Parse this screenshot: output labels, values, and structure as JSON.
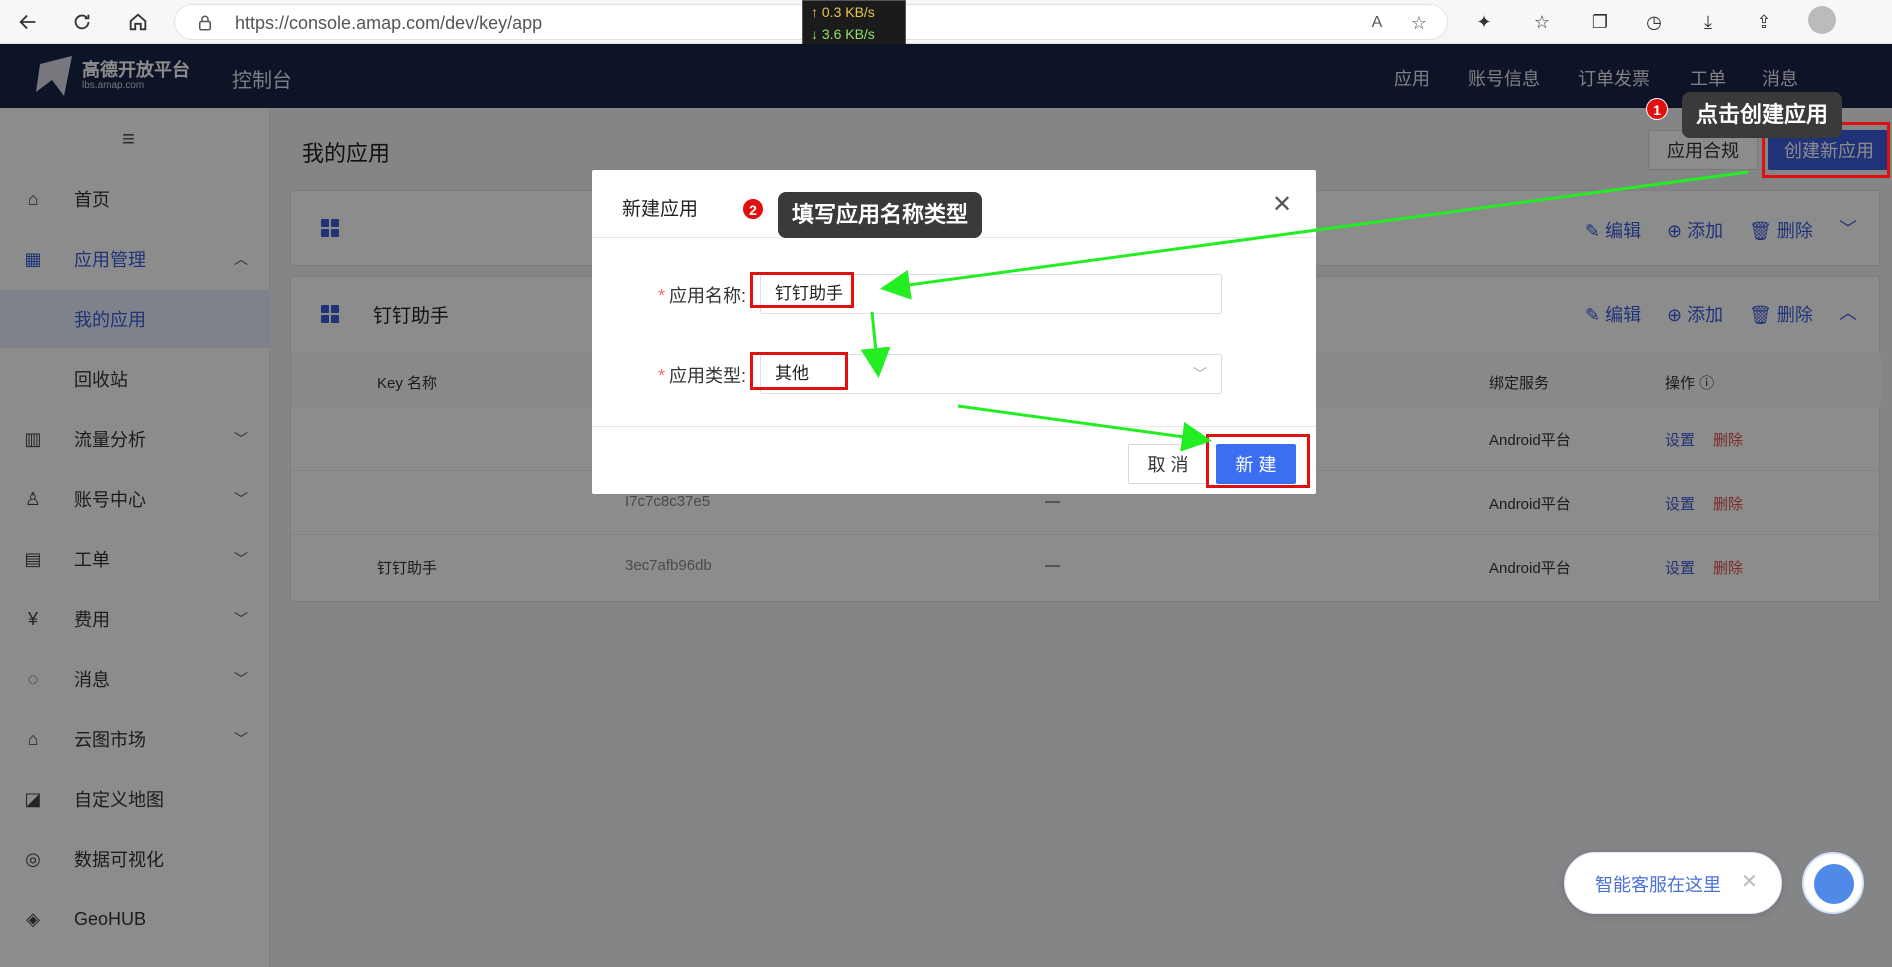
{
  "browser": {
    "url": "https://console.amap.com/dev/key/app",
    "net_up": "↑ 0.3 KB/s",
    "net_down": "↓ 3.6 KB/s"
  },
  "header": {
    "logo_title": "高德开放平台",
    "logo_sub": "lbs.amap.com",
    "console": "控制台",
    "nav": [
      "应用",
      "账号信息",
      "订单发票",
      "工单",
      "消息"
    ]
  },
  "sidebar": {
    "items": [
      {
        "label": "首页"
      },
      {
        "label": "应用管理"
      },
      {
        "label": "我的应用"
      },
      {
        "label": "回收站"
      },
      {
        "label": "流量分析"
      },
      {
        "label": "账号中心"
      },
      {
        "label": "工单"
      },
      {
        "label": "费用"
      },
      {
        "label": "消息"
      },
      {
        "label": "云图市场"
      },
      {
        "label": "自定义地图"
      },
      {
        "label": "数据可视化"
      },
      {
        "label": "GeoHUB"
      }
    ]
  },
  "main": {
    "title": "我的应用",
    "compliance_btn": "应用合规",
    "create_btn": "创建新应用",
    "actions": {
      "edit": "编辑",
      "add": "添加",
      "delete": "删除"
    },
    "app2_name": "钉钉助手",
    "table": {
      "headers": [
        "Key 名称",
        "绑定服务",
        "操作 ⓘ"
      ],
      "rows": [
        {
          "name": "",
          "key": "",
          "dash": "",
          "service": "Android平台",
          "set": "设置",
          "del": "删除"
        },
        {
          "name": "",
          "key": "I7c7c8c37e5",
          "dash": "—",
          "service": "Android平台",
          "set": "设置",
          "del": "删除"
        },
        {
          "name": "钉钉助手",
          "key": "3ec7afb96db",
          "dash": "—",
          "service": "Android平台",
          "set": "设置",
          "del": "删除"
        }
      ]
    }
  },
  "modal": {
    "title": "新建应用",
    "name_label": "应用名称:",
    "name_value": "钉钉助手",
    "type_label": "应用类型:",
    "type_value": "其他",
    "cancel": "取 消",
    "submit": "新 建"
  },
  "annotations": {
    "badge1": "1",
    "tip1": "点击创建应用",
    "badge2": "2",
    "tip2": "填写应用名称类型"
  },
  "chat": {
    "text": "智能客服在这里"
  },
  "colors": {
    "primary": "#3b5bdb",
    "header_bg": "#1a2547",
    "annotation_red": "#e01010",
    "arrow_green": "#22ee22"
  }
}
